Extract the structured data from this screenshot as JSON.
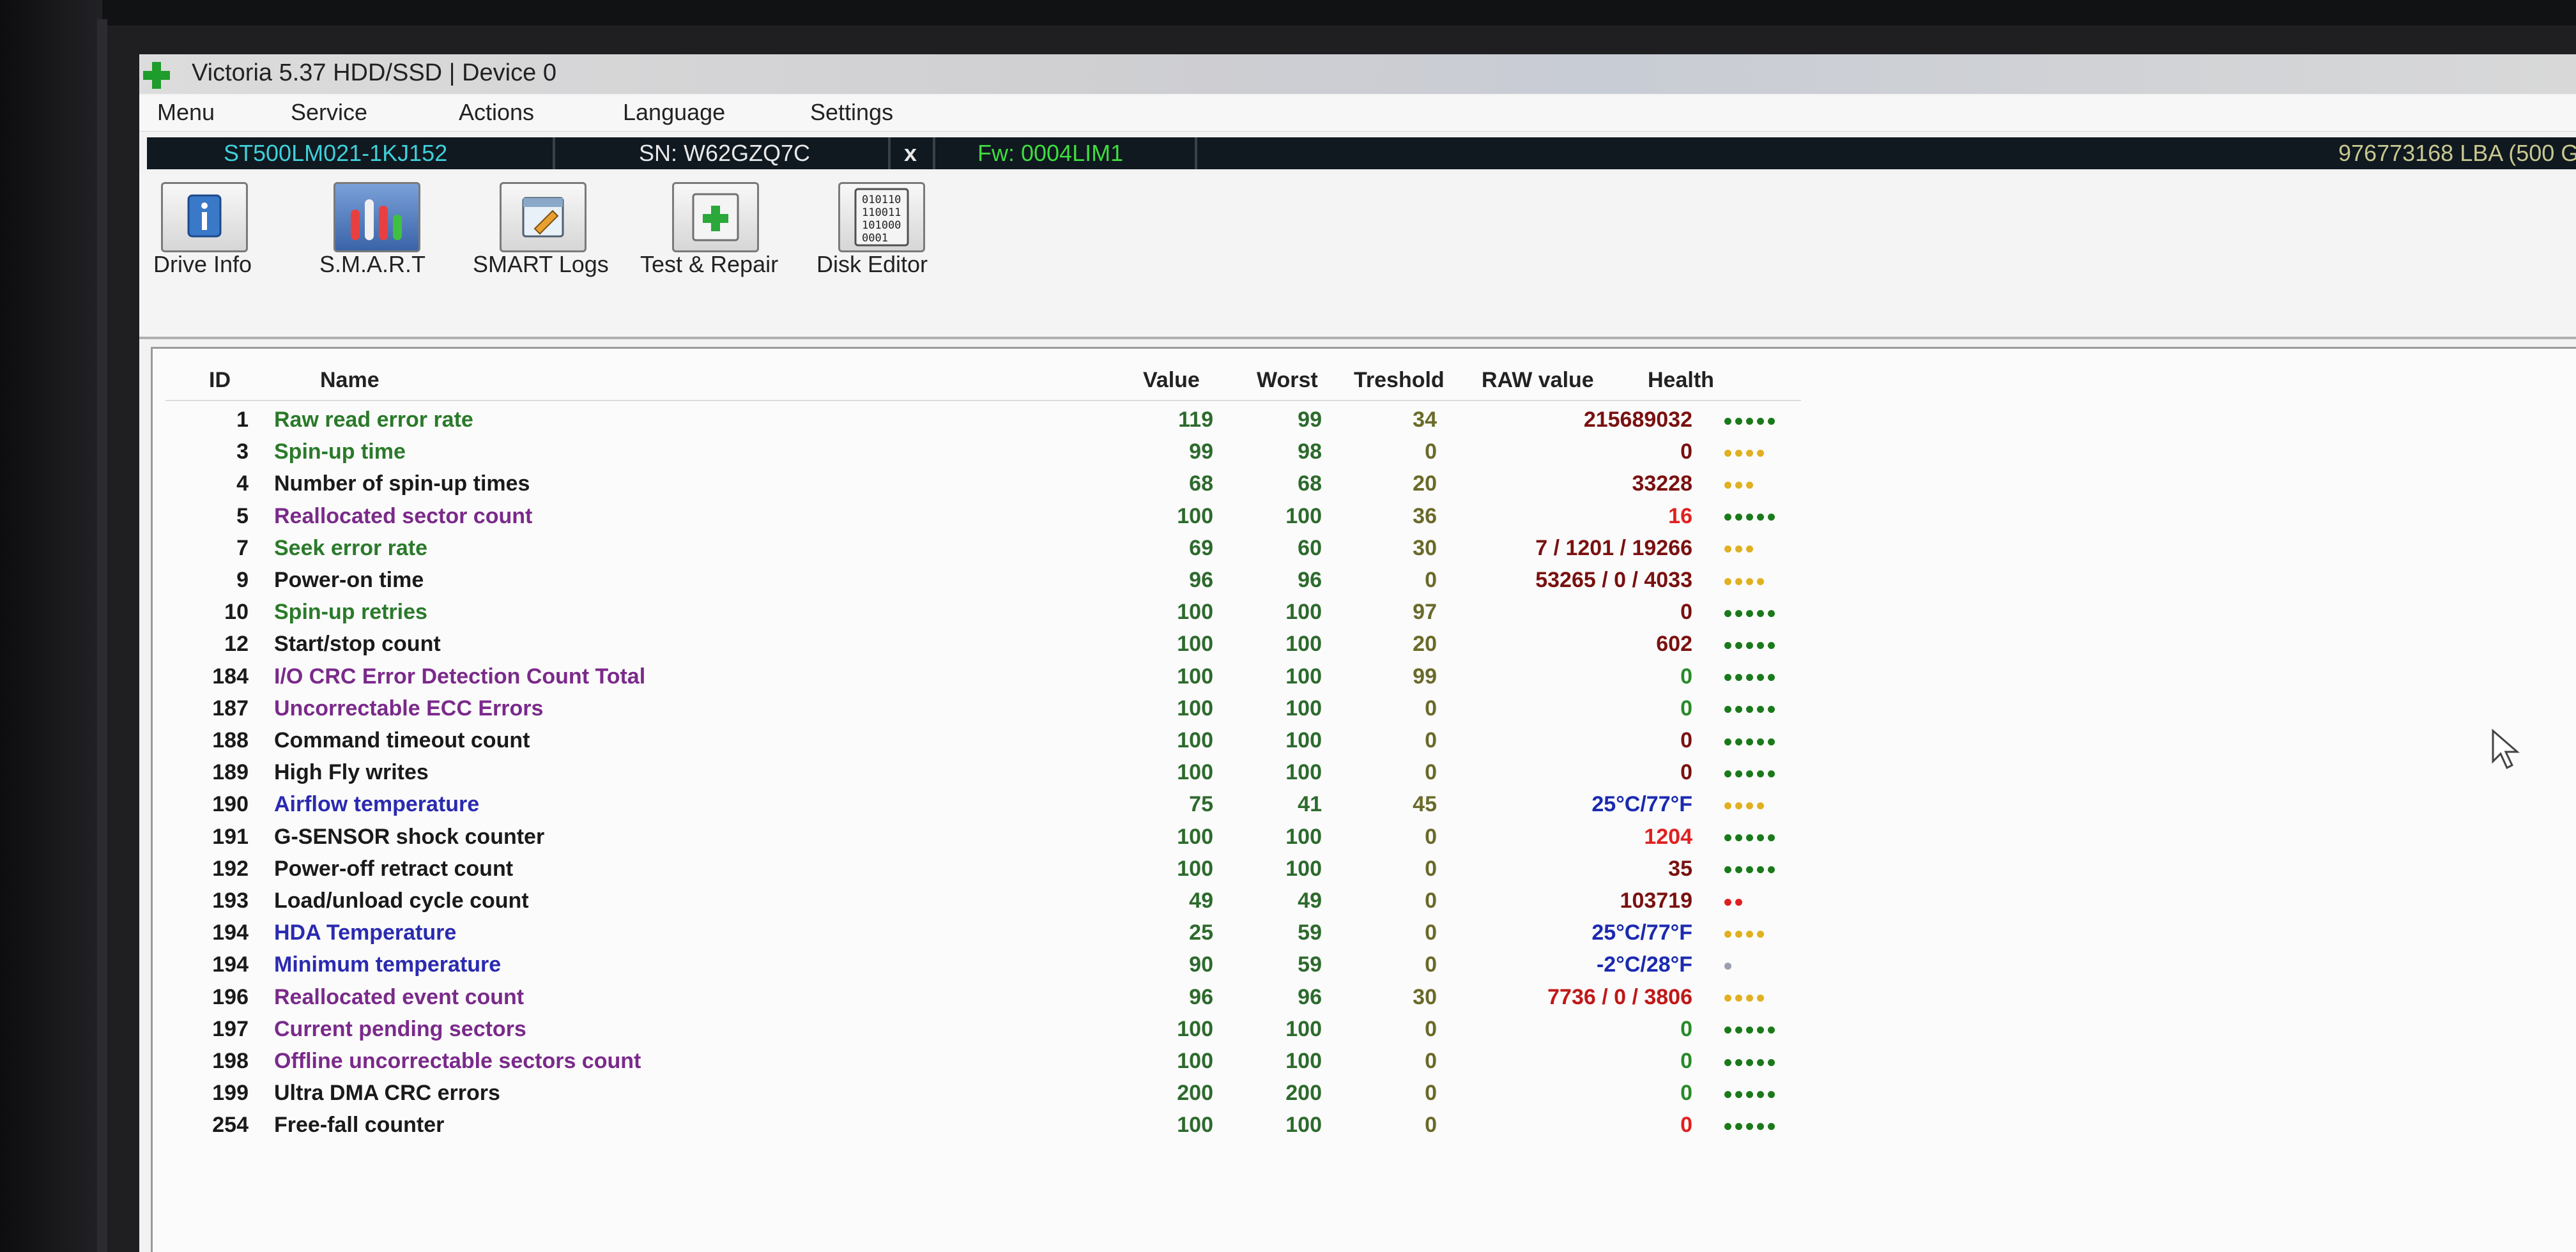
{
  "window": {
    "title": "Victoria 5.37 HDD/SSD | Device 0"
  },
  "menu": [
    "Menu",
    "Service",
    "Actions",
    "Language",
    "Settings"
  ],
  "device": {
    "model": "ST500LM021-1KJ152",
    "serial": "SN: W62GZQ7C",
    "close": "x",
    "firmware": "Fw: 0004LIM1",
    "capacity": "976773168 LBA (500 G",
    "colors": {
      "model": "#3fd0d8",
      "serial": "#e8e8e8",
      "firmware": "#3fdc3f",
      "capacity": "#c8c890"
    }
  },
  "toolbar": [
    {
      "label": "Drive Info",
      "icon": "info-icon"
    },
    {
      "label": "S.M.A.R.T",
      "icon": "smart-chart-icon"
    },
    {
      "label": "SMART Logs",
      "icon": "logs-icon"
    },
    {
      "label": "Test & Repair",
      "icon": "repair-icon"
    },
    {
      "label": "Disk Editor",
      "icon": "binary-icon"
    }
  ],
  "table": {
    "headers": {
      "id": "ID",
      "name": "Name",
      "value": "Value",
      "worst": "Worst",
      "threshold": "Treshold",
      "raw": "RAW value",
      "health": "Health"
    },
    "rows": [
      {
        "id": "1",
        "name": "Raw read error rate",
        "value": "119",
        "worst": "99",
        "threshold": "34",
        "raw": "215689032",
        "name_color": "#2a7a2a",
        "raw_color": "#7a1010",
        "health": 5,
        "health_color": "#1a7a1a"
      },
      {
        "id": "3",
        "name": "Spin-up time",
        "value": "99",
        "worst": "98",
        "threshold": "0",
        "raw": "0",
        "name_color": "#2a7a2a",
        "raw_color": "#7a1010",
        "health": 4,
        "health_color": "#e0b020"
      },
      {
        "id": "4",
        "name": "Number of spin-up times",
        "value": "68",
        "worst": "68",
        "threshold": "20",
        "raw": "33228",
        "name_color": "#1a1a1a",
        "raw_color": "#7a1010",
        "health": 3,
        "health_color": "#e0b020"
      },
      {
        "id": "5",
        "name": "Reallocated sector count",
        "value": "100",
        "worst": "100",
        "threshold": "36",
        "raw": "16",
        "name_color": "#7a2a8a",
        "raw_color": "#e02020",
        "health": 5,
        "health_color": "#1a7a1a"
      },
      {
        "id": "7",
        "name": "Seek error rate",
        "value": "69",
        "worst": "60",
        "threshold": "30",
        "raw": "7 / 1201 / 19266",
        "name_color": "#2a7a2a",
        "raw_color": "#7a1010",
        "health": 3,
        "health_color": "#e0b020"
      },
      {
        "id": "9",
        "name": "Power-on time",
        "value": "96",
        "worst": "96",
        "threshold": "0",
        "raw": "53265 / 0 / 4033",
        "name_color": "#1a1a1a",
        "raw_color": "#7a1010",
        "health": 4,
        "health_color": "#e0b020"
      },
      {
        "id": "10",
        "name": "Spin-up retries",
        "value": "100",
        "worst": "100",
        "threshold": "97",
        "raw": "0",
        "name_color": "#2a7a2a",
        "raw_color": "#7a1010",
        "health": 5,
        "health_color": "#1a7a1a"
      },
      {
        "id": "12",
        "name": "Start/stop count",
        "value": "100",
        "worst": "100",
        "threshold": "20",
        "raw": "602",
        "name_color": "#1a1a1a",
        "raw_color": "#7a1010",
        "health": 5,
        "health_color": "#1a7a1a"
      },
      {
        "id": "184",
        "name": "I/O CRC Error Detection Count Total",
        "value": "100",
        "worst": "100",
        "threshold": "99",
        "raw": "0",
        "name_color": "#7a2a8a",
        "raw_color": "#2a8a2a",
        "health": 5,
        "health_color": "#1a7a1a"
      },
      {
        "id": "187",
        "name": "Uncorrectable ECC Errors",
        "value": "100",
        "worst": "100",
        "threshold": "0",
        "raw": "0",
        "name_color": "#7a2a8a",
        "raw_color": "#2a8a2a",
        "health": 5,
        "health_color": "#1a7a1a"
      },
      {
        "id": "188",
        "name": "Command timeout count",
        "value": "100",
        "worst": "100",
        "threshold": "0",
        "raw": "0",
        "name_color": "#1a1a1a",
        "raw_color": "#7a1010",
        "health": 5,
        "health_color": "#1a7a1a"
      },
      {
        "id": "189",
        "name": "High Fly writes",
        "value": "100",
        "worst": "100",
        "threshold": "0",
        "raw": "0",
        "name_color": "#1a1a1a",
        "raw_color": "#7a1010",
        "health": 5,
        "health_color": "#1a7a1a"
      },
      {
        "id": "190",
        "name": "Airflow temperature",
        "value": "75",
        "worst": "41",
        "threshold": "45",
        "raw": "25°C/77°F",
        "name_color": "#2a2ab0",
        "raw_color": "#1a2ab0",
        "health": 4,
        "health_color": "#e0b020"
      },
      {
        "id": "191",
        "name": "G-SENSOR shock counter",
        "value": "100",
        "worst": "100",
        "threshold": "0",
        "raw": "1204",
        "name_color": "#1a1a1a",
        "raw_color": "#e02020",
        "health": 5,
        "health_color": "#1a7a1a"
      },
      {
        "id": "192",
        "name": "Power-off retract count",
        "value": "100",
        "worst": "100",
        "threshold": "0",
        "raw": "35",
        "name_color": "#1a1a1a",
        "raw_color": "#7a1010",
        "health": 5,
        "health_color": "#1a7a1a"
      },
      {
        "id": "193",
        "name": "Load/unload cycle count",
        "value": "49",
        "worst": "49",
        "threshold": "0",
        "raw": "103719",
        "name_color": "#1a1a1a",
        "raw_color": "#7a1010",
        "health": 2,
        "health_color": "#e02020"
      },
      {
        "id": "194",
        "name": "HDA Temperature",
        "value": "25",
        "worst": "59",
        "threshold": "0",
        "raw": "25°C/77°F",
        "name_color": "#2a2ab0",
        "raw_color": "#1a2ab0",
        "health": 4,
        "health_color": "#e0b020"
      },
      {
        "id": "194",
        "name": "Minimum temperature",
        "value": "90",
        "worst": "59",
        "threshold": "0",
        "raw": "-2°C/28°F",
        "name_color": "#2a2ab0",
        "raw_color": "#1a2ab0",
        "health": 1,
        "health_color": "#9aa0b0"
      },
      {
        "id": "196",
        "name": "Reallocated event count",
        "value": "96",
        "worst": "96",
        "threshold": "30",
        "raw": "7736 / 0 / 3806",
        "name_color": "#7a2a8a",
        "raw_color": "#c01818",
        "health": 4,
        "health_color": "#e0b020"
      },
      {
        "id": "197",
        "name": "Current pending sectors",
        "value": "100",
        "worst": "100",
        "threshold": "0",
        "raw": "0",
        "name_color": "#7a2a8a",
        "raw_color": "#2a8a2a",
        "health": 5,
        "health_color": "#1a7a1a"
      },
      {
        "id": "198",
        "name": "Offline uncorrectable sectors count",
        "value": "100",
        "worst": "100",
        "threshold": "0",
        "raw": "0",
        "name_color": "#7a2a8a",
        "raw_color": "#2a8a2a",
        "health": 5,
        "health_color": "#1a7a1a"
      },
      {
        "id": "199",
        "name": "Ultra DMA CRC errors",
        "value": "200",
        "worst": "200",
        "threshold": "0",
        "raw": "0",
        "name_color": "#1a1a1a",
        "raw_color": "#2a8a2a",
        "health": 5,
        "health_color": "#1a7a1a"
      },
      {
        "id": "254",
        "name": "Free-fall counter",
        "value": "100",
        "worst": "100",
        "threshold": "0",
        "raw": "0",
        "name_color": "#1a1a1a",
        "raw_color": "#e02020",
        "health": 5,
        "health_color": "#1a7a1a"
      }
    ]
  }
}
